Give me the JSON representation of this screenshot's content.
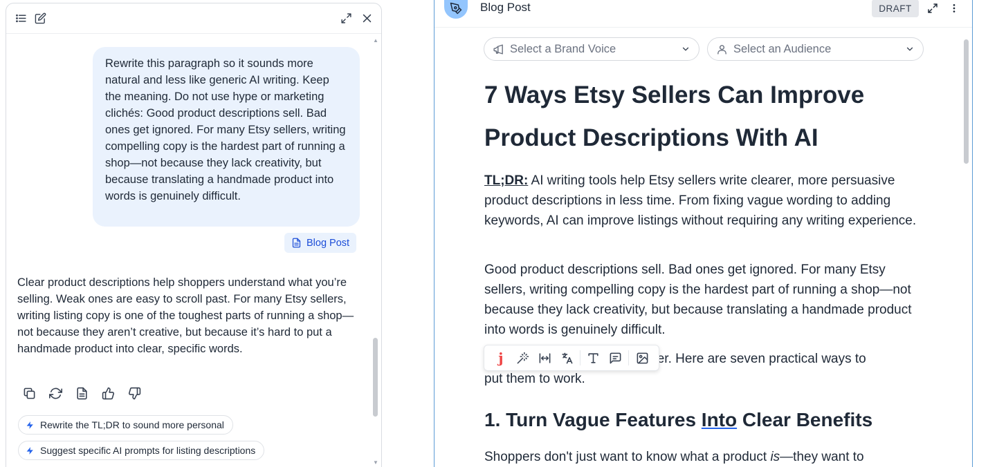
{
  "chat": {
    "user_message": "Rewrite this paragraph so it sounds more natural and less like generic AI writing. Keep the meaning. Do not use hype or marketing clichés: Good product descriptions sell. Bad ones get ignored. For many Etsy sellers, writing compelling copy is the hardest part of running a shop—not because they lack creativity, but because translating a handmade product into words is genuinely difficult.",
    "attachment_label": "Blog Post",
    "assistant_reply": "Clear product descriptions help shoppers understand what you’re selling. Weak ones are easy to scroll past. For many Etsy sellers, writing listing copy is one of the toughest parts of running a shop—not because they aren’t creative, but because it’s hard to put a handmade product into clear, specific words.",
    "suggestions": [
      "Rewrite the TL;DR to sound more personal",
      "Suggest specific AI prompts for listing descriptions"
    ]
  },
  "editor": {
    "title": "Blog Post",
    "status_badge": "DRAFT",
    "brand_voice_placeholder": "Select a Brand Voice",
    "audience_placeholder": "Select an Audience",
    "heading": "7 Ways Etsy Sellers Can Improve Product Descriptions With AI",
    "tldr_label": "TL;DR:",
    "tldr_text": " AI writing tools help Etsy sellers write clearer, more persuasive product descriptions in less time. From fixing vague wording to adding keywords, AI can improve listings without requiring any writing experience.",
    "paragraph_1": "Good product descriptions sell. Bad ones get ignored. For many Etsy sellers, writing compelling copy is the hardest part of running a shop—not because they lack creativity, but because translating a handmade product into words is genuinely difficult.",
    "paragraph_2_visible_tail": "sier. Here are seven practical ways to",
    "paragraph_2_line2": "put them to work.",
    "section_heading_before": "1. Turn Vague Features ",
    "section_heading_underlined": "Into",
    "section_heading_after": " Clear Benefits",
    "paragraph_3_before": "Shoppers don't just want to know what a product ",
    "paragraph_3_em": "is",
    "paragraph_3_after": "—they want to",
    "toolbar_j": "j"
  },
  "colors": {
    "accent": "#2563eb",
    "bubble_bg": "#eaf2fd",
    "editor_border": "#5b9bd5",
    "avatar_bg": "#93c5fd"
  }
}
